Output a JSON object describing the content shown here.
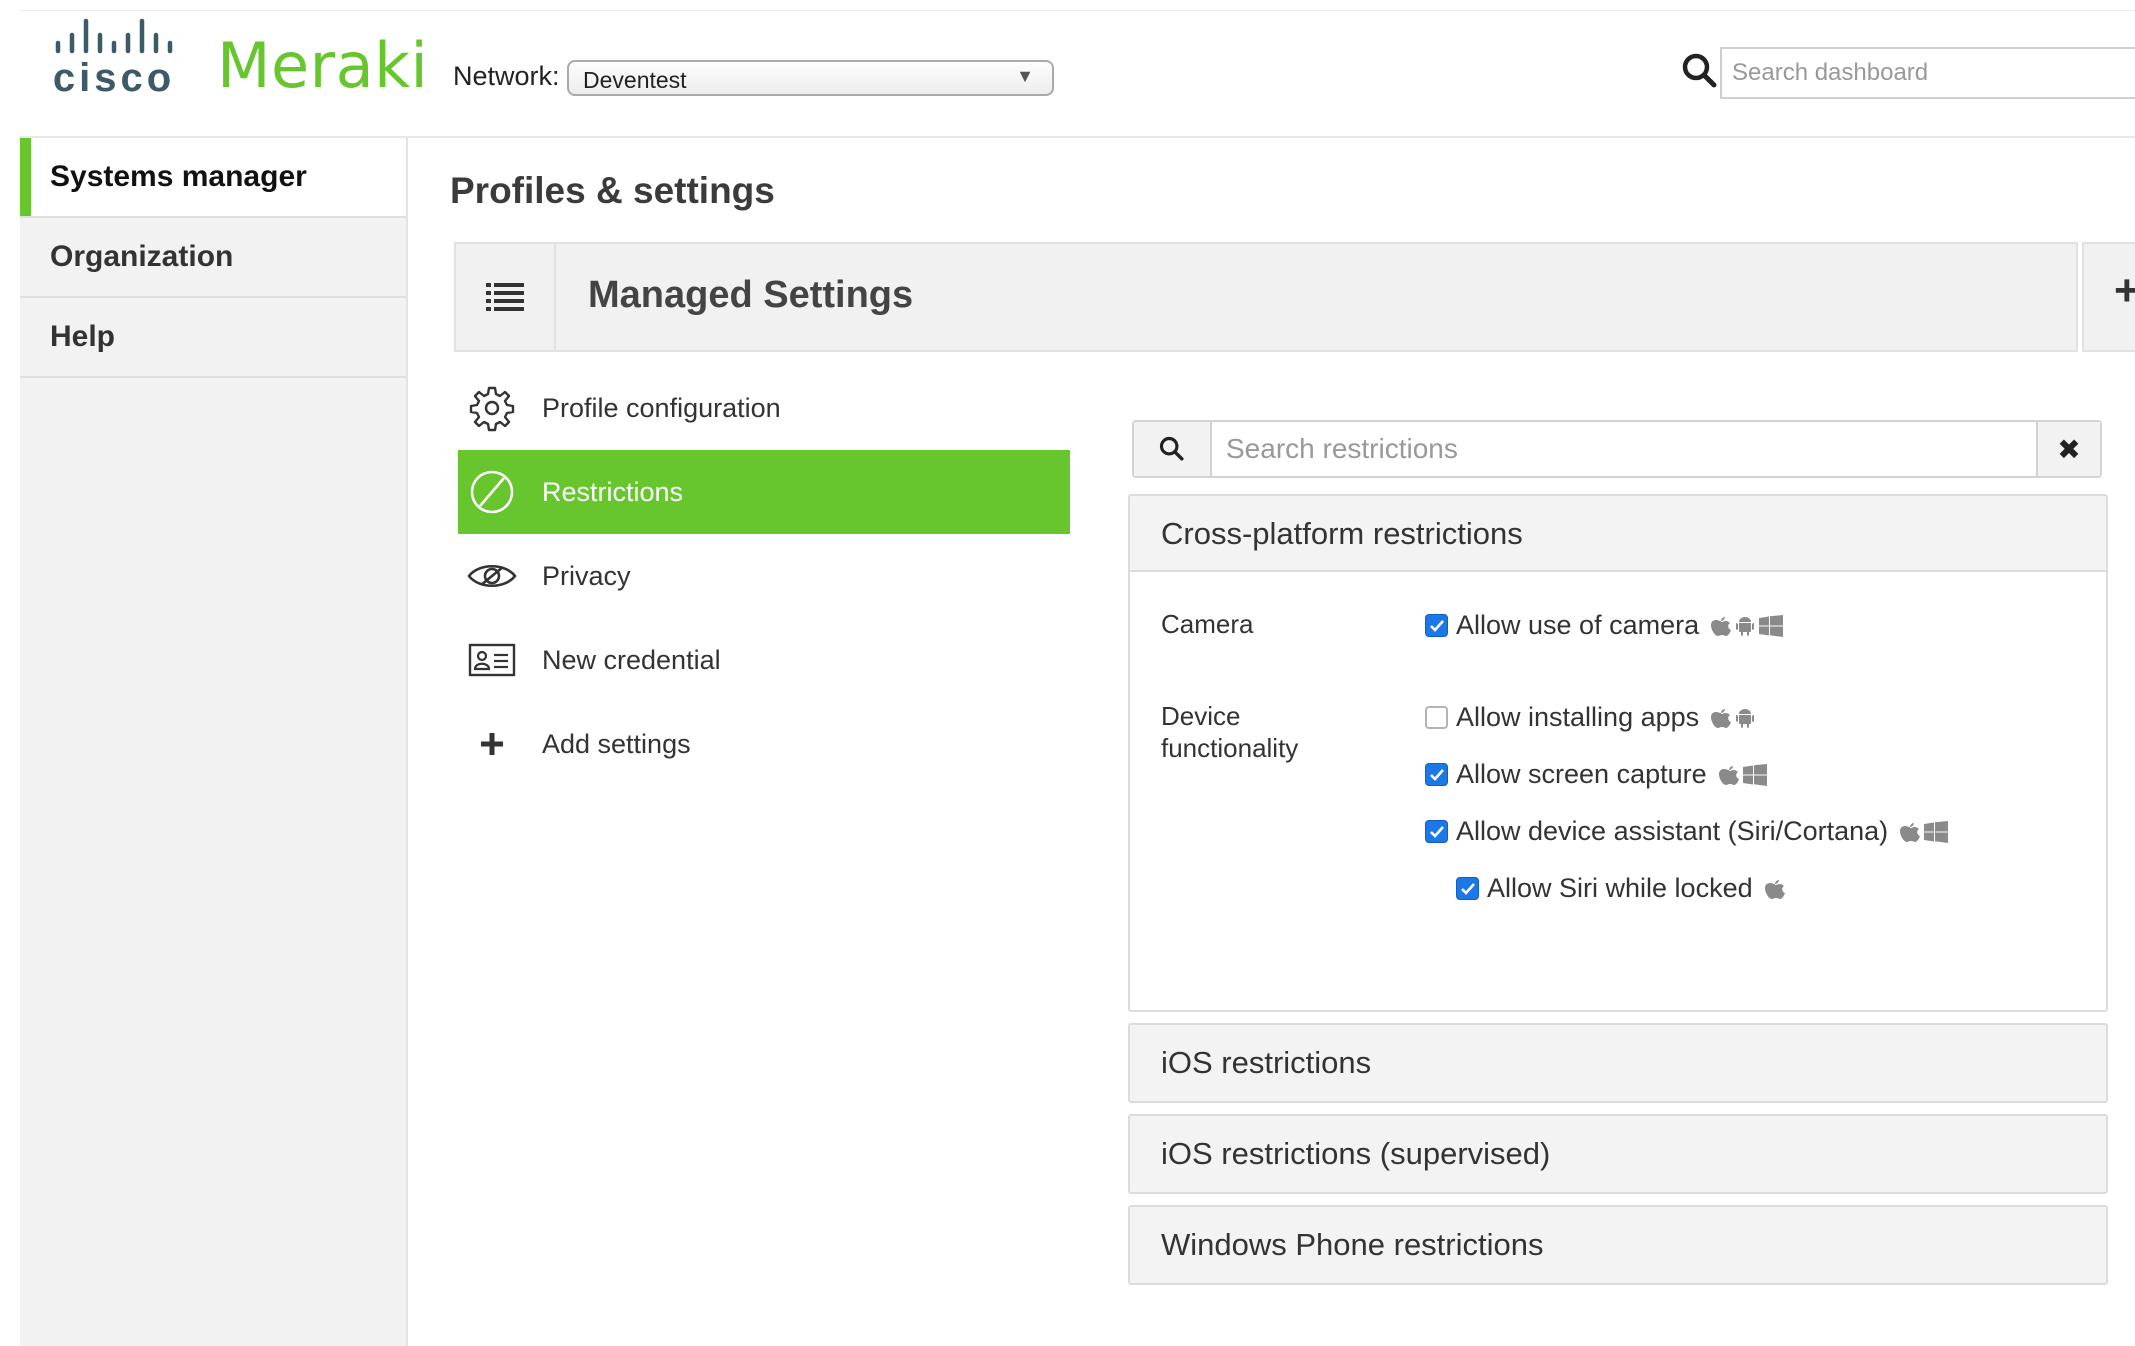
{
  "header": {
    "brand_cisco": "cisco",
    "brand_meraki": "Meraki",
    "network_label": "Network:",
    "network_value": "Deventest",
    "search_placeholder": "Search dashboard"
  },
  "sidebar": {
    "items": [
      {
        "label": "Systems manager",
        "active": true
      },
      {
        "label": "Organization",
        "active": false
      },
      {
        "label": "Help",
        "active": false
      }
    ]
  },
  "main": {
    "page_title": "Profiles & settings",
    "profile_title": "Managed Settings",
    "settings_nav": [
      {
        "label": "Profile configuration",
        "icon": "gear-icon",
        "active": false
      },
      {
        "label": "Restrictions",
        "icon": "restricted-icon",
        "active": true
      },
      {
        "label": "Privacy",
        "icon": "eye-icon",
        "active": false
      },
      {
        "label": "New credential",
        "icon": "id-card-icon",
        "active": false
      },
      {
        "label": "Add settings",
        "icon": "plus-icon",
        "active": false
      }
    ],
    "restrictions_search_placeholder": "Search restrictions",
    "panels": [
      {
        "title": "Cross-platform restrictions",
        "expanded": true
      },
      {
        "title": "iOS restrictions",
        "expanded": false
      },
      {
        "title": "iOS restrictions (supervised)",
        "expanded": false
      },
      {
        "title": "Windows Phone restrictions",
        "expanded": false
      }
    ],
    "cross_platform": {
      "camera_label": "Camera",
      "device_label_1": "Device",
      "device_label_2": "functionality",
      "options": [
        {
          "label": "Allow use of camera",
          "checked": true,
          "platforms": [
            "apple",
            "android",
            "windows"
          ]
        },
        {
          "label": "Allow installing apps",
          "checked": false,
          "platforms": [
            "apple",
            "android"
          ]
        },
        {
          "label": "Allow screen capture",
          "checked": true,
          "platforms": [
            "apple",
            "windows"
          ]
        },
        {
          "label": "Allow device assistant (Siri/Cortana)",
          "checked": true,
          "platforms": [
            "apple",
            "windows"
          ]
        },
        {
          "label": "Allow Siri while locked",
          "checked": true,
          "platforms": [
            "apple"
          ]
        }
      ]
    }
  },
  "colors": {
    "brand_green": "#67c52e",
    "checkbox_blue": "#1b78e6"
  }
}
